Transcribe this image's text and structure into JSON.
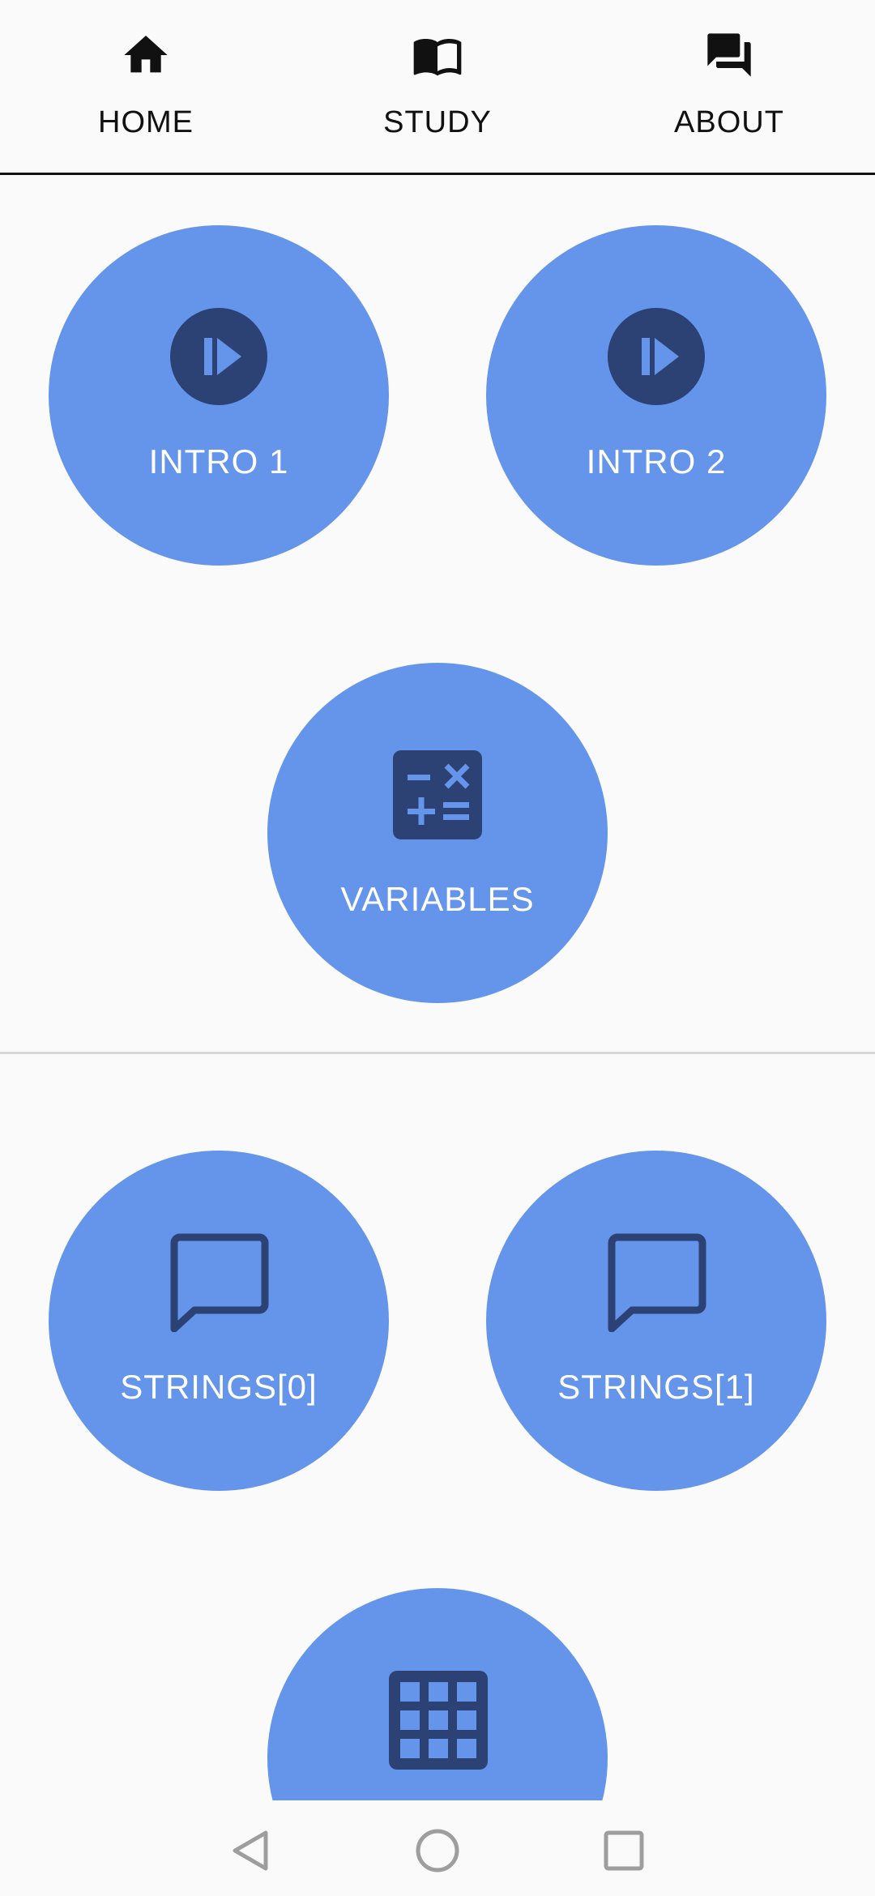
{
  "tabs": [
    {
      "label": "HOME",
      "icon": "home-icon"
    },
    {
      "label": "STUDY",
      "icon": "book-icon"
    },
    {
      "label": "ABOUT",
      "icon": "forum-icon"
    }
  ],
  "lessons": [
    {
      "label": "INTRO 1",
      "icon": "play-circle-icon"
    },
    {
      "label": "INTRO 2",
      "icon": "play-circle-icon"
    },
    {
      "label": "VARIABLES",
      "icon": "calculator-icon"
    },
    {
      "label": "STRINGS[0]",
      "icon": "chat-bubble-icon"
    },
    {
      "label": "STRINGS[1]",
      "icon": "chat-bubble-icon"
    },
    {
      "label": "",
      "icon": "grid-icon"
    }
  ],
  "colors": {
    "circle": "#6495ea",
    "icon_dark": "#2c4274",
    "background": "#fafafa",
    "nav_gray": "#9e9e9e"
  },
  "navbar": {
    "back": "back-icon",
    "home": "home-circle-icon",
    "recents": "recents-icon"
  }
}
